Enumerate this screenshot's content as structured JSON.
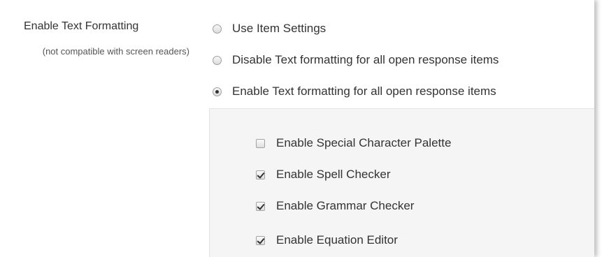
{
  "setting": {
    "label": "Enable Text Formatting",
    "note": "(not compatible with screen readers)"
  },
  "radios": [
    {
      "label": "Use Item Settings",
      "checked": false
    },
    {
      "label": "Disable Text formatting for all open response items",
      "checked": false
    },
    {
      "label": "Enable Text formatting for all open response items",
      "checked": true
    }
  ],
  "checkboxes": [
    {
      "label": "Enable Special Character Palette",
      "checked": false
    },
    {
      "label": "Enable Spell Checker",
      "checked": true
    },
    {
      "label": "Enable Grammar Checker",
      "checked": true
    },
    {
      "label": "Enable Equation Editor",
      "checked": true
    }
  ]
}
